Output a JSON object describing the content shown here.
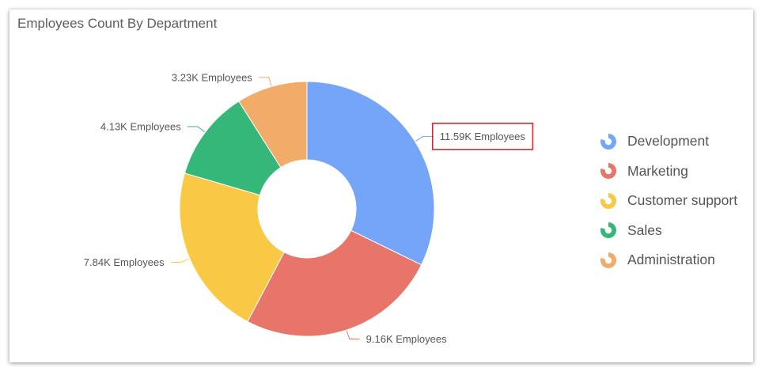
{
  "card": {
    "title": "Employees Count By Department"
  },
  "chart_data": {
    "type": "pie",
    "donut": true,
    "title": "Employees Count By Department",
    "categories": [
      "Development",
      "Marketing",
      "Customer support",
      "Sales",
      "Administration"
    ],
    "values": [
      11.59,
      9.16,
      7.84,
      4.13,
      3.23
    ],
    "unit": "K Employees",
    "data_labels": [
      "11.59K Employees",
      "9.16K Employees",
      "7.84K Employees",
      "4.13K Employees",
      "3.23K Employees"
    ],
    "colors": [
      "#74a5f8",
      "#e7756a",
      "#f9c945",
      "#36b77a",
      "#f0ac68"
    ],
    "legend_placement": "right",
    "highlighted_label": "11.59K Employees",
    "highlight_color": "#d9262b"
  }
}
